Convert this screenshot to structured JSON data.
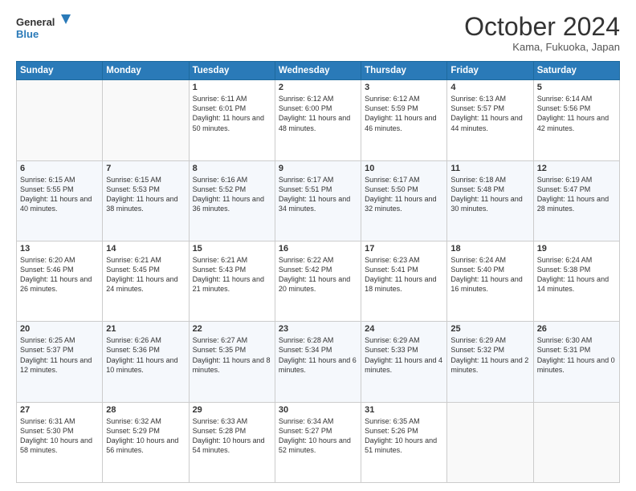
{
  "logo": {
    "line1": "General",
    "line2": "Blue",
    "icon_color": "#2a7ab8"
  },
  "title": "October 2024",
  "location": "Kama, Fukuoka, Japan",
  "header_days": [
    "Sunday",
    "Monday",
    "Tuesday",
    "Wednesday",
    "Thursday",
    "Friday",
    "Saturday"
  ],
  "weeks": [
    [
      {
        "day": "",
        "sunrise": "",
        "sunset": "",
        "daylight": ""
      },
      {
        "day": "",
        "sunrise": "",
        "sunset": "",
        "daylight": ""
      },
      {
        "day": "1",
        "sunrise": "Sunrise: 6:11 AM",
        "sunset": "Sunset: 6:01 PM",
        "daylight": "Daylight: 11 hours and 50 minutes."
      },
      {
        "day": "2",
        "sunrise": "Sunrise: 6:12 AM",
        "sunset": "Sunset: 6:00 PM",
        "daylight": "Daylight: 11 hours and 48 minutes."
      },
      {
        "day": "3",
        "sunrise": "Sunrise: 6:12 AM",
        "sunset": "Sunset: 5:59 PM",
        "daylight": "Daylight: 11 hours and 46 minutes."
      },
      {
        "day": "4",
        "sunrise": "Sunrise: 6:13 AM",
        "sunset": "Sunset: 5:57 PM",
        "daylight": "Daylight: 11 hours and 44 minutes."
      },
      {
        "day": "5",
        "sunrise": "Sunrise: 6:14 AM",
        "sunset": "Sunset: 5:56 PM",
        "daylight": "Daylight: 11 hours and 42 minutes."
      }
    ],
    [
      {
        "day": "6",
        "sunrise": "Sunrise: 6:15 AM",
        "sunset": "Sunset: 5:55 PM",
        "daylight": "Daylight: 11 hours and 40 minutes."
      },
      {
        "day": "7",
        "sunrise": "Sunrise: 6:15 AM",
        "sunset": "Sunset: 5:53 PM",
        "daylight": "Daylight: 11 hours and 38 minutes."
      },
      {
        "day": "8",
        "sunrise": "Sunrise: 6:16 AM",
        "sunset": "Sunset: 5:52 PM",
        "daylight": "Daylight: 11 hours and 36 minutes."
      },
      {
        "day": "9",
        "sunrise": "Sunrise: 6:17 AM",
        "sunset": "Sunset: 5:51 PM",
        "daylight": "Daylight: 11 hours and 34 minutes."
      },
      {
        "day": "10",
        "sunrise": "Sunrise: 6:17 AM",
        "sunset": "Sunset: 5:50 PM",
        "daylight": "Daylight: 11 hours and 32 minutes."
      },
      {
        "day": "11",
        "sunrise": "Sunrise: 6:18 AM",
        "sunset": "Sunset: 5:48 PM",
        "daylight": "Daylight: 11 hours and 30 minutes."
      },
      {
        "day": "12",
        "sunrise": "Sunrise: 6:19 AM",
        "sunset": "Sunset: 5:47 PM",
        "daylight": "Daylight: 11 hours and 28 minutes."
      }
    ],
    [
      {
        "day": "13",
        "sunrise": "Sunrise: 6:20 AM",
        "sunset": "Sunset: 5:46 PM",
        "daylight": "Daylight: 11 hours and 26 minutes."
      },
      {
        "day": "14",
        "sunrise": "Sunrise: 6:21 AM",
        "sunset": "Sunset: 5:45 PM",
        "daylight": "Daylight: 11 hours and 24 minutes."
      },
      {
        "day": "15",
        "sunrise": "Sunrise: 6:21 AM",
        "sunset": "Sunset: 5:43 PM",
        "daylight": "Daylight: 11 hours and 21 minutes."
      },
      {
        "day": "16",
        "sunrise": "Sunrise: 6:22 AM",
        "sunset": "Sunset: 5:42 PM",
        "daylight": "Daylight: 11 hours and 20 minutes."
      },
      {
        "day": "17",
        "sunrise": "Sunrise: 6:23 AM",
        "sunset": "Sunset: 5:41 PM",
        "daylight": "Daylight: 11 hours and 18 minutes."
      },
      {
        "day": "18",
        "sunrise": "Sunrise: 6:24 AM",
        "sunset": "Sunset: 5:40 PM",
        "daylight": "Daylight: 11 hours and 16 minutes."
      },
      {
        "day": "19",
        "sunrise": "Sunrise: 6:24 AM",
        "sunset": "Sunset: 5:38 PM",
        "daylight": "Daylight: 11 hours and 14 minutes."
      }
    ],
    [
      {
        "day": "20",
        "sunrise": "Sunrise: 6:25 AM",
        "sunset": "Sunset: 5:37 PM",
        "daylight": "Daylight: 11 hours and 12 minutes."
      },
      {
        "day": "21",
        "sunrise": "Sunrise: 6:26 AM",
        "sunset": "Sunset: 5:36 PM",
        "daylight": "Daylight: 11 hours and 10 minutes."
      },
      {
        "day": "22",
        "sunrise": "Sunrise: 6:27 AM",
        "sunset": "Sunset: 5:35 PM",
        "daylight": "Daylight: 11 hours and 8 minutes."
      },
      {
        "day": "23",
        "sunrise": "Sunrise: 6:28 AM",
        "sunset": "Sunset: 5:34 PM",
        "daylight": "Daylight: 11 hours and 6 minutes."
      },
      {
        "day": "24",
        "sunrise": "Sunrise: 6:29 AM",
        "sunset": "Sunset: 5:33 PM",
        "daylight": "Daylight: 11 hours and 4 minutes."
      },
      {
        "day": "25",
        "sunrise": "Sunrise: 6:29 AM",
        "sunset": "Sunset: 5:32 PM",
        "daylight": "Daylight: 11 hours and 2 minutes."
      },
      {
        "day": "26",
        "sunrise": "Sunrise: 6:30 AM",
        "sunset": "Sunset: 5:31 PM",
        "daylight": "Daylight: 11 hours and 0 minutes."
      }
    ],
    [
      {
        "day": "27",
        "sunrise": "Sunrise: 6:31 AM",
        "sunset": "Sunset: 5:30 PM",
        "daylight": "Daylight: 10 hours and 58 minutes."
      },
      {
        "day": "28",
        "sunrise": "Sunrise: 6:32 AM",
        "sunset": "Sunset: 5:29 PM",
        "daylight": "Daylight: 10 hours and 56 minutes."
      },
      {
        "day": "29",
        "sunrise": "Sunrise: 6:33 AM",
        "sunset": "Sunset: 5:28 PM",
        "daylight": "Daylight: 10 hours and 54 minutes."
      },
      {
        "day": "30",
        "sunrise": "Sunrise: 6:34 AM",
        "sunset": "Sunset: 5:27 PM",
        "daylight": "Daylight: 10 hours and 52 minutes."
      },
      {
        "day": "31",
        "sunrise": "Sunrise: 6:35 AM",
        "sunset": "Sunset: 5:26 PM",
        "daylight": "Daylight: 10 hours and 51 minutes."
      },
      {
        "day": "",
        "sunrise": "",
        "sunset": "",
        "daylight": ""
      },
      {
        "day": "",
        "sunrise": "",
        "sunset": "",
        "daylight": ""
      }
    ]
  ]
}
